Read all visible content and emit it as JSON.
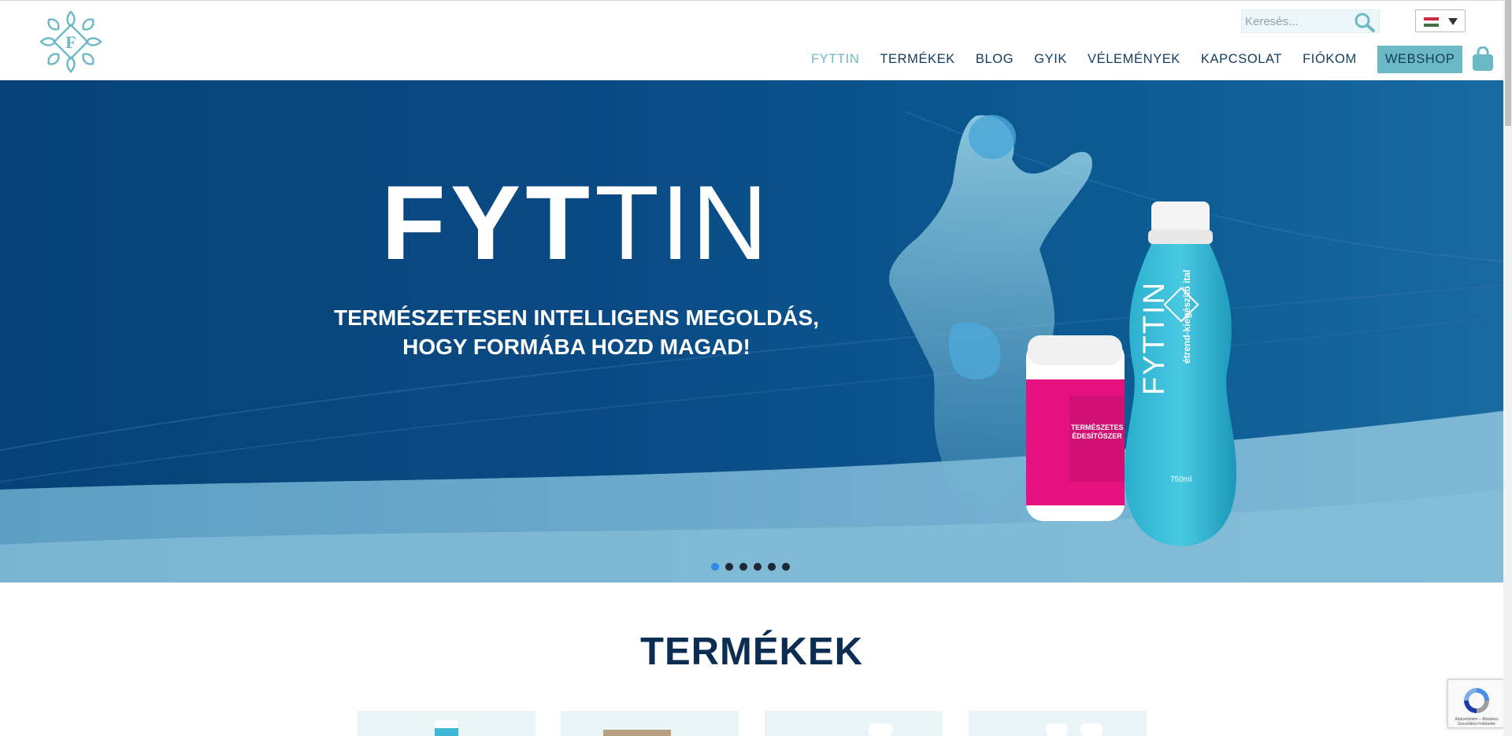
{
  "header": {
    "search_placeholder": "Keresés...",
    "language_flag": "hungarian-flag-icon",
    "nav": {
      "items": [
        {
          "label": "FYTTIN",
          "active": true
        },
        {
          "label": "TERMÉKEK",
          "active": false
        },
        {
          "label": "BLOG",
          "active": false
        },
        {
          "label": "GYIK",
          "active": false
        },
        {
          "label": "VÉLEMÉNYEK",
          "active": false
        },
        {
          "label": "KAPCSOLAT",
          "active": false
        },
        {
          "label": "FIÓKOM",
          "active": false
        }
      ],
      "webshop_label": "WEBSHOP"
    }
  },
  "hero": {
    "brand_bold": "FYT",
    "brand_light": "TIN",
    "tagline_line1": "TERMÉSZETESEN INTELLIGENS MEGOLDÁS,",
    "tagline_line2": "HOGY FORMÁBA HOZD MAGAD!",
    "bottle_brand": "FYTTIN",
    "bottle_text": "étrend-kiegészítő ital",
    "bottle_volume": "750ml",
    "jar_label_1": "TERMÉSZETES",
    "jar_label_2": "ÉDESÍTŐSZER",
    "slider": {
      "count": 6,
      "active_index": 0
    }
  },
  "products": {
    "title": "TERMÉKEK"
  },
  "recaptcha": {
    "text": "Adatvédelem – Általános Szerződési Feltételek"
  },
  "colors": {
    "navy": "#123c5e",
    "teal": "#6cb9c6",
    "hero_blue": "#0a4a84",
    "bottle_cyan": "#2fb8d3",
    "jar_pink": "#e4117f"
  }
}
